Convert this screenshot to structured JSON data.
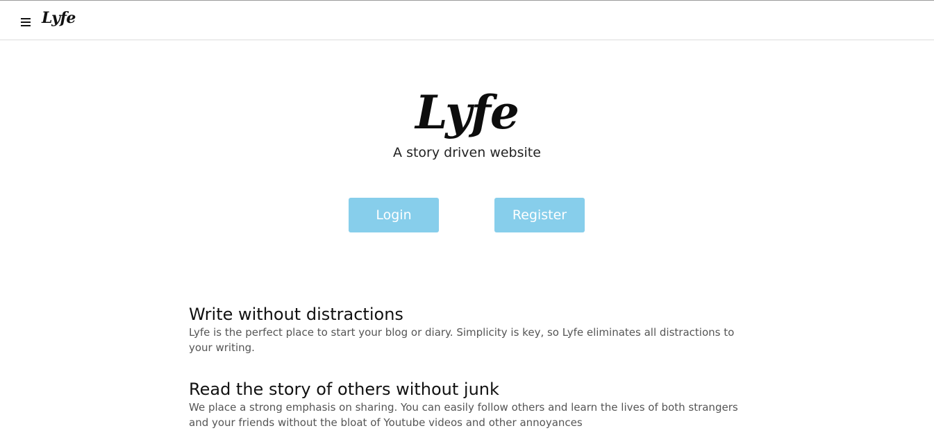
{
  "navbar": {
    "menu_icon": "hamburger-menu-icon",
    "logo": "Lyfe"
  },
  "hero": {
    "logo": "Lyfe",
    "tagline": "A story driven website",
    "login_label": "Login",
    "register_label": "Register",
    "button_color": "#87ceeb"
  },
  "features": [
    {
      "title": "Write without distractions",
      "body": "Lyfe is the perfect place to start your blog or diary. Simplicity is key, so Lyfe eliminates all distractions to your writing."
    },
    {
      "title": "Read the story of others without junk",
      "body": "We place a strong emphasis on sharing. You can easily follow others and learn the lives of both strangers and your friends without the bloat of Youtube videos and other annoyances"
    }
  ]
}
